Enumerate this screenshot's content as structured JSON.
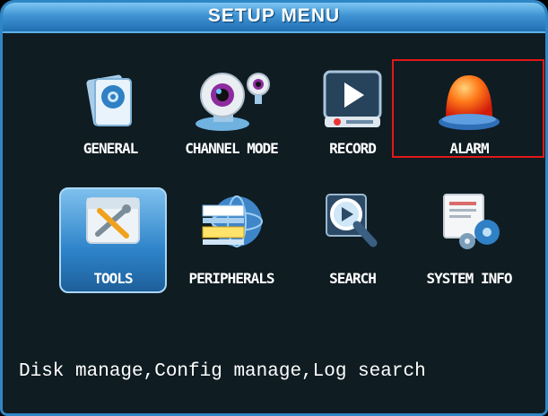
{
  "window": {
    "title": "SETUP  MENU"
  },
  "menu": {
    "items": [
      {
        "id": "general",
        "label": "GENERAL",
        "icon": "general-settings-icon"
      },
      {
        "id": "channel-mode",
        "label": "CHANNEL MODE",
        "icon": "webcam-icon"
      },
      {
        "id": "record",
        "label": "RECORD",
        "icon": "record-play-icon"
      },
      {
        "id": "alarm",
        "label": "ALARM",
        "icon": "alarm-siren-icon"
      },
      {
        "id": "tools",
        "label": "TOOLS",
        "icon": "tools-icon"
      },
      {
        "id": "peripherals",
        "label": "PERIPHERALS",
        "icon": "peripherals-globe-icon"
      },
      {
        "id": "search",
        "label": "SEARCH",
        "icon": "search-magnifier-icon"
      },
      {
        "id": "system-info",
        "label": "SYSTEM INFO",
        "icon": "system-info-gears-icon"
      }
    ],
    "highlighted": "TOOLS",
    "outlined": "ALARM"
  },
  "status": {
    "text": "Disk manage,Config manage,Log search"
  },
  "colors": {
    "title_bar": "#3f93d3",
    "background": "#0f1c22",
    "highlight": "#2d83c9",
    "outline": "#e21818"
  }
}
